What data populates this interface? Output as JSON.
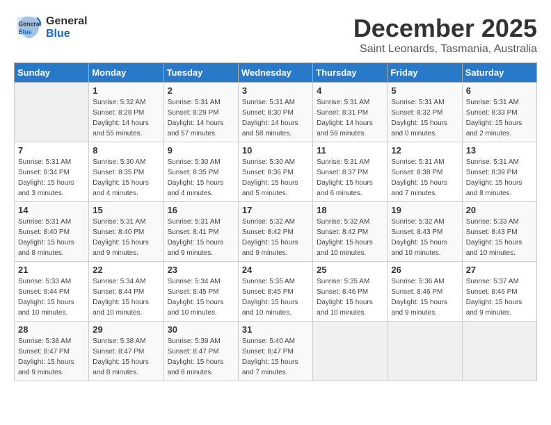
{
  "logo": {
    "line1": "General",
    "line2": "Blue"
  },
  "title": "December 2025",
  "subtitle": "Saint Leonards, Tasmania, Australia",
  "weekdays": [
    "Sunday",
    "Monday",
    "Tuesday",
    "Wednesday",
    "Thursday",
    "Friday",
    "Saturday"
  ],
  "weeks": [
    [
      {
        "day": "",
        "info": ""
      },
      {
        "day": "1",
        "info": "Sunrise: 5:32 AM\nSunset: 8:28 PM\nDaylight: 14 hours\nand 55 minutes."
      },
      {
        "day": "2",
        "info": "Sunrise: 5:31 AM\nSunset: 8:29 PM\nDaylight: 14 hours\nand 57 minutes."
      },
      {
        "day": "3",
        "info": "Sunrise: 5:31 AM\nSunset: 8:30 PM\nDaylight: 14 hours\nand 58 minutes."
      },
      {
        "day": "4",
        "info": "Sunrise: 5:31 AM\nSunset: 8:31 PM\nDaylight: 14 hours\nand 59 minutes."
      },
      {
        "day": "5",
        "info": "Sunrise: 5:31 AM\nSunset: 8:32 PM\nDaylight: 15 hours\nand 0 minutes."
      },
      {
        "day": "6",
        "info": "Sunrise: 5:31 AM\nSunset: 8:33 PM\nDaylight: 15 hours\nand 2 minutes."
      }
    ],
    [
      {
        "day": "7",
        "info": "Sunrise: 5:31 AM\nSunset: 8:34 PM\nDaylight: 15 hours\nand 3 minutes."
      },
      {
        "day": "8",
        "info": "Sunrise: 5:30 AM\nSunset: 8:35 PM\nDaylight: 15 hours\nand 4 minutes."
      },
      {
        "day": "9",
        "info": "Sunrise: 5:30 AM\nSunset: 8:35 PM\nDaylight: 15 hours\nand 4 minutes."
      },
      {
        "day": "10",
        "info": "Sunrise: 5:30 AM\nSunset: 8:36 PM\nDaylight: 15 hours\nand 5 minutes."
      },
      {
        "day": "11",
        "info": "Sunrise: 5:31 AM\nSunset: 8:37 PM\nDaylight: 15 hours\nand 6 minutes."
      },
      {
        "day": "12",
        "info": "Sunrise: 5:31 AM\nSunset: 8:38 PM\nDaylight: 15 hours\nand 7 minutes."
      },
      {
        "day": "13",
        "info": "Sunrise: 5:31 AM\nSunset: 8:39 PM\nDaylight: 15 hours\nand 8 minutes."
      }
    ],
    [
      {
        "day": "14",
        "info": "Sunrise: 5:31 AM\nSunset: 8:40 PM\nDaylight: 15 hours\nand 8 minutes."
      },
      {
        "day": "15",
        "info": "Sunrise: 5:31 AM\nSunset: 8:40 PM\nDaylight: 15 hours\nand 9 minutes."
      },
      {
        "day": "16",
        "info": "Sunrise: 5:31 AM\nSunset: 8:41 PM\nDaylight: 15 hours\nand 9 minutes."
      },
      {
        "day": "17",
        "info": "Sunrise: 5:32 AM\nSunset: 8:42 PM\nDaylight: 15 hours\nand 9 minutes."
      },
      {
        "day": "18",
        "info": "Sunrise: 5:32 AM\nSunset: 8:42 PM\nDaylight: 15 hours\nand 10 minutes."
      },
      {
        "day": "19",
        "info": "Sunrise: 5:32 AM\nSunset: 8:43 PM\nDaylight: 15 hours\nand 10 minutes."
      },
      {
        "day": "20",
        "info": "Sunrise: 5:33 AM\nSunset: 8:43 PM\nDaylight: 15 hours\nand 10 minutes."
      }
    ],
    [
      {
        "day": "21",
        "info": "Sunrise: 5:33 AM\nSunset: 8:44 PM\nDaylight: 15 hours\nand 10 minutes."
      },
      {
        "day": "22",
        "info": "Sunrise: 5:34 AM\nSunset: 8:44 PM\nDaylight: 15 hours\nand 10 minutes."
      },
      {
        "day": "23",
        "info": "Sunrise: 5:34 AM\nSunset: 8:45 PM\nDaylight: 15 hours\nand 10 minutes."
      },
      {
        "day": "24",
        "info": "Sunrise: 5:35 AM\nSunset: 8:45 PM\nDaylight: 15 hours\nand 10 minutes."
      },
      {
        "day": "25",
        "info": "Sunrise: 5:35 AM\nSunset: 8:46 PM\nDaylight: 15 hours\nand 10 minutes."
      },
      {
        "day": "26",
        "info": "Sunrise: 5:36 AM\nSunset: 8:46 PM\nDaylight: 15 hours\nand 9 minutes."
      },
      {
        "day": "27",
        "info": "Sunrise: 5:37 AM\nSunset: 8:46 PM\nDaylight: 15 hours\nand 9 minutes."
      }
    ],
    [
      {
        "day": "28",
        "info": "Sunrise: 5:38 AM\nSunset: 8:47 PM\nDaylight: 15 hours\nand 9 minutes."
      },
      {
        "day": "29",
        "info": "Sunrise: 5:38 AM\nSunset: 8:47 PM\nDaylight: 15 hours\nand 8 minutes."
      },
      {
        "day": "30",
        "info": "Sunrise: 5:39 AM\nSunset: 8:47 PM\nDaylight: 15 hours\nand 8 minutes."
      },
      {
        "day": "31",
        "info": "Sunrise: 5:40 AM\nSunset: 8:47 PM\nDaylight: 15 hours\nand 7 minutes."
      },
      {
        "day": "",
        "info": ""
      },
      {
        "day": "",
        "info": ""
      },
      {
        "day": "",
        "info": ""
      }
    ]
  ]
}
